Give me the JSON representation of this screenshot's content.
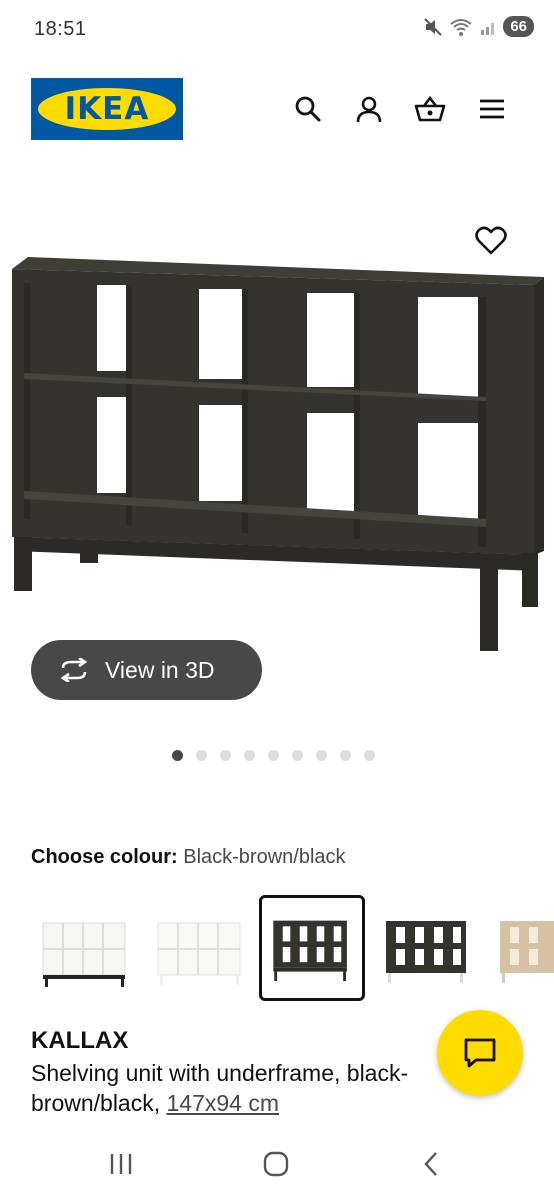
{
  "status_bar": {
    "time": "18:51",
    "battery": "66",
    "icons": [
      "mute-icon",
      "wifi-icon",
      "signal-icon",
      "battery-icon"
    ]
  },
  "header": {
    "logo_text": "IKEA",
    "icons": [
      "search-icon",
      "account-icon",
      "basket-icon",
      "menu-icon"
    ]
  },
  "gallery": {
    "view_3d_label": "View in 3D",
    "dot_count": 9,
    "active_dot": 1
  },
  "colour": {
    "label": "Choose colour:",
    "selected": "Black-brown/black",
    "swatches": [
      {
        "name": "white-black"
      },
      {
        "name": "white"
      },
      {
        "name": "black-brown-black",
        "selected": true
      },
      {
        "name": "black-brown-white"
      },
      {
        "name": "oak-effect-white"
      }
    ]
  },
  "product": {
    "name": "KALLAX",
    "description": "Shelving unit with underframe, black-",
    "description_line2": "brown/black,",
    "size": "147x94 cm"
  },
  "colors": {
    "ikea_blue": "#0058a3",
    "ikea_yellow": "#ffdb00",
    "button_dark": "#484848"
  }
}
